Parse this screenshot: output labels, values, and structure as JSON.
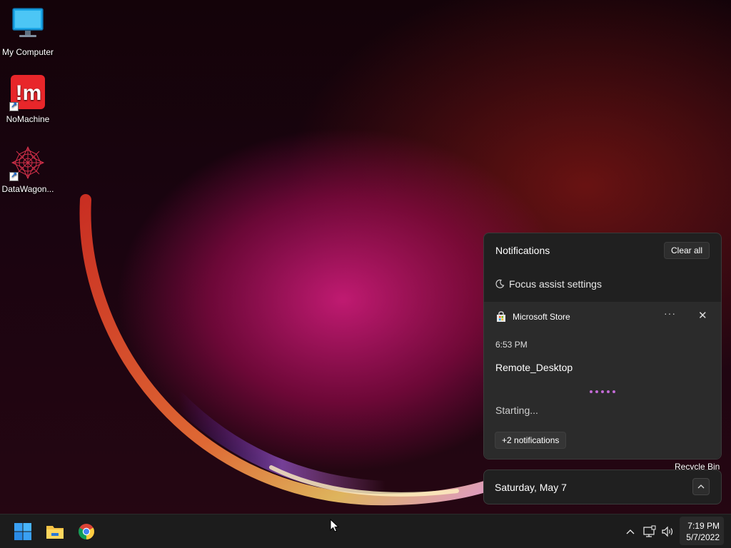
{
  "desktop": {
    "icons": [
      {
        "label": "My Computer",
        "icon": "monitor-icon"
      },
      {
        "label": "NoMachine",
        "icon": "nomachine-icon"
      },
      {
        "label": "DataWagon...",
        "icon": "datawagon-icon"
      }
    ],
    "recycle_bin_label": "Recycle Bin"
  },
  "notification_center": {
    "title": "Notifications",
    "clear_all_label": "Clear all",
    "focus_assist_label": "Focus assist settings",
    "focus_icon": "moon-icon",
    "card": {
      "app_name": "Microsoft Store",
      "app_icon": "store-icon",
      "more_label": "···",
      "close_label": "✕",
      "time": "6:53 PM",
      "title": "Remote_Desktop",
      "status": "Starting...",
      "more_notifications_label": "+2 notifications"
    }
  },
  "calendar_flyout": {
    "date": "Saturday, May 7",
    "toggle_icon": "chevron-up-icon"
  },
  "taskbar": {
    "pinned": [
      {
        "name": "start-button",
        "icon": "windows-logo-icon"
      },
      {
        "name": "file-explorer-button",
        "icon": "folder-icon"
      },
      {
        "name": "chrome-button",
        "icon": "chrome-icon"
      }
    ],
    "tray_icons": [
      "chevron-up-icon",
      "network-icon",
      "volume-icon"
    ],
    "clock": {
      "time": "7:19 PM",
      "date": "5/7/2022"
    }
  },
  "colors": {
    "panel_bg": "#202020",
    "card_bg": "#2b2b2b",
    "taskbar_bg": "#1c1c1c",
    "progress_accent": "#c36bd6"
  }
}
